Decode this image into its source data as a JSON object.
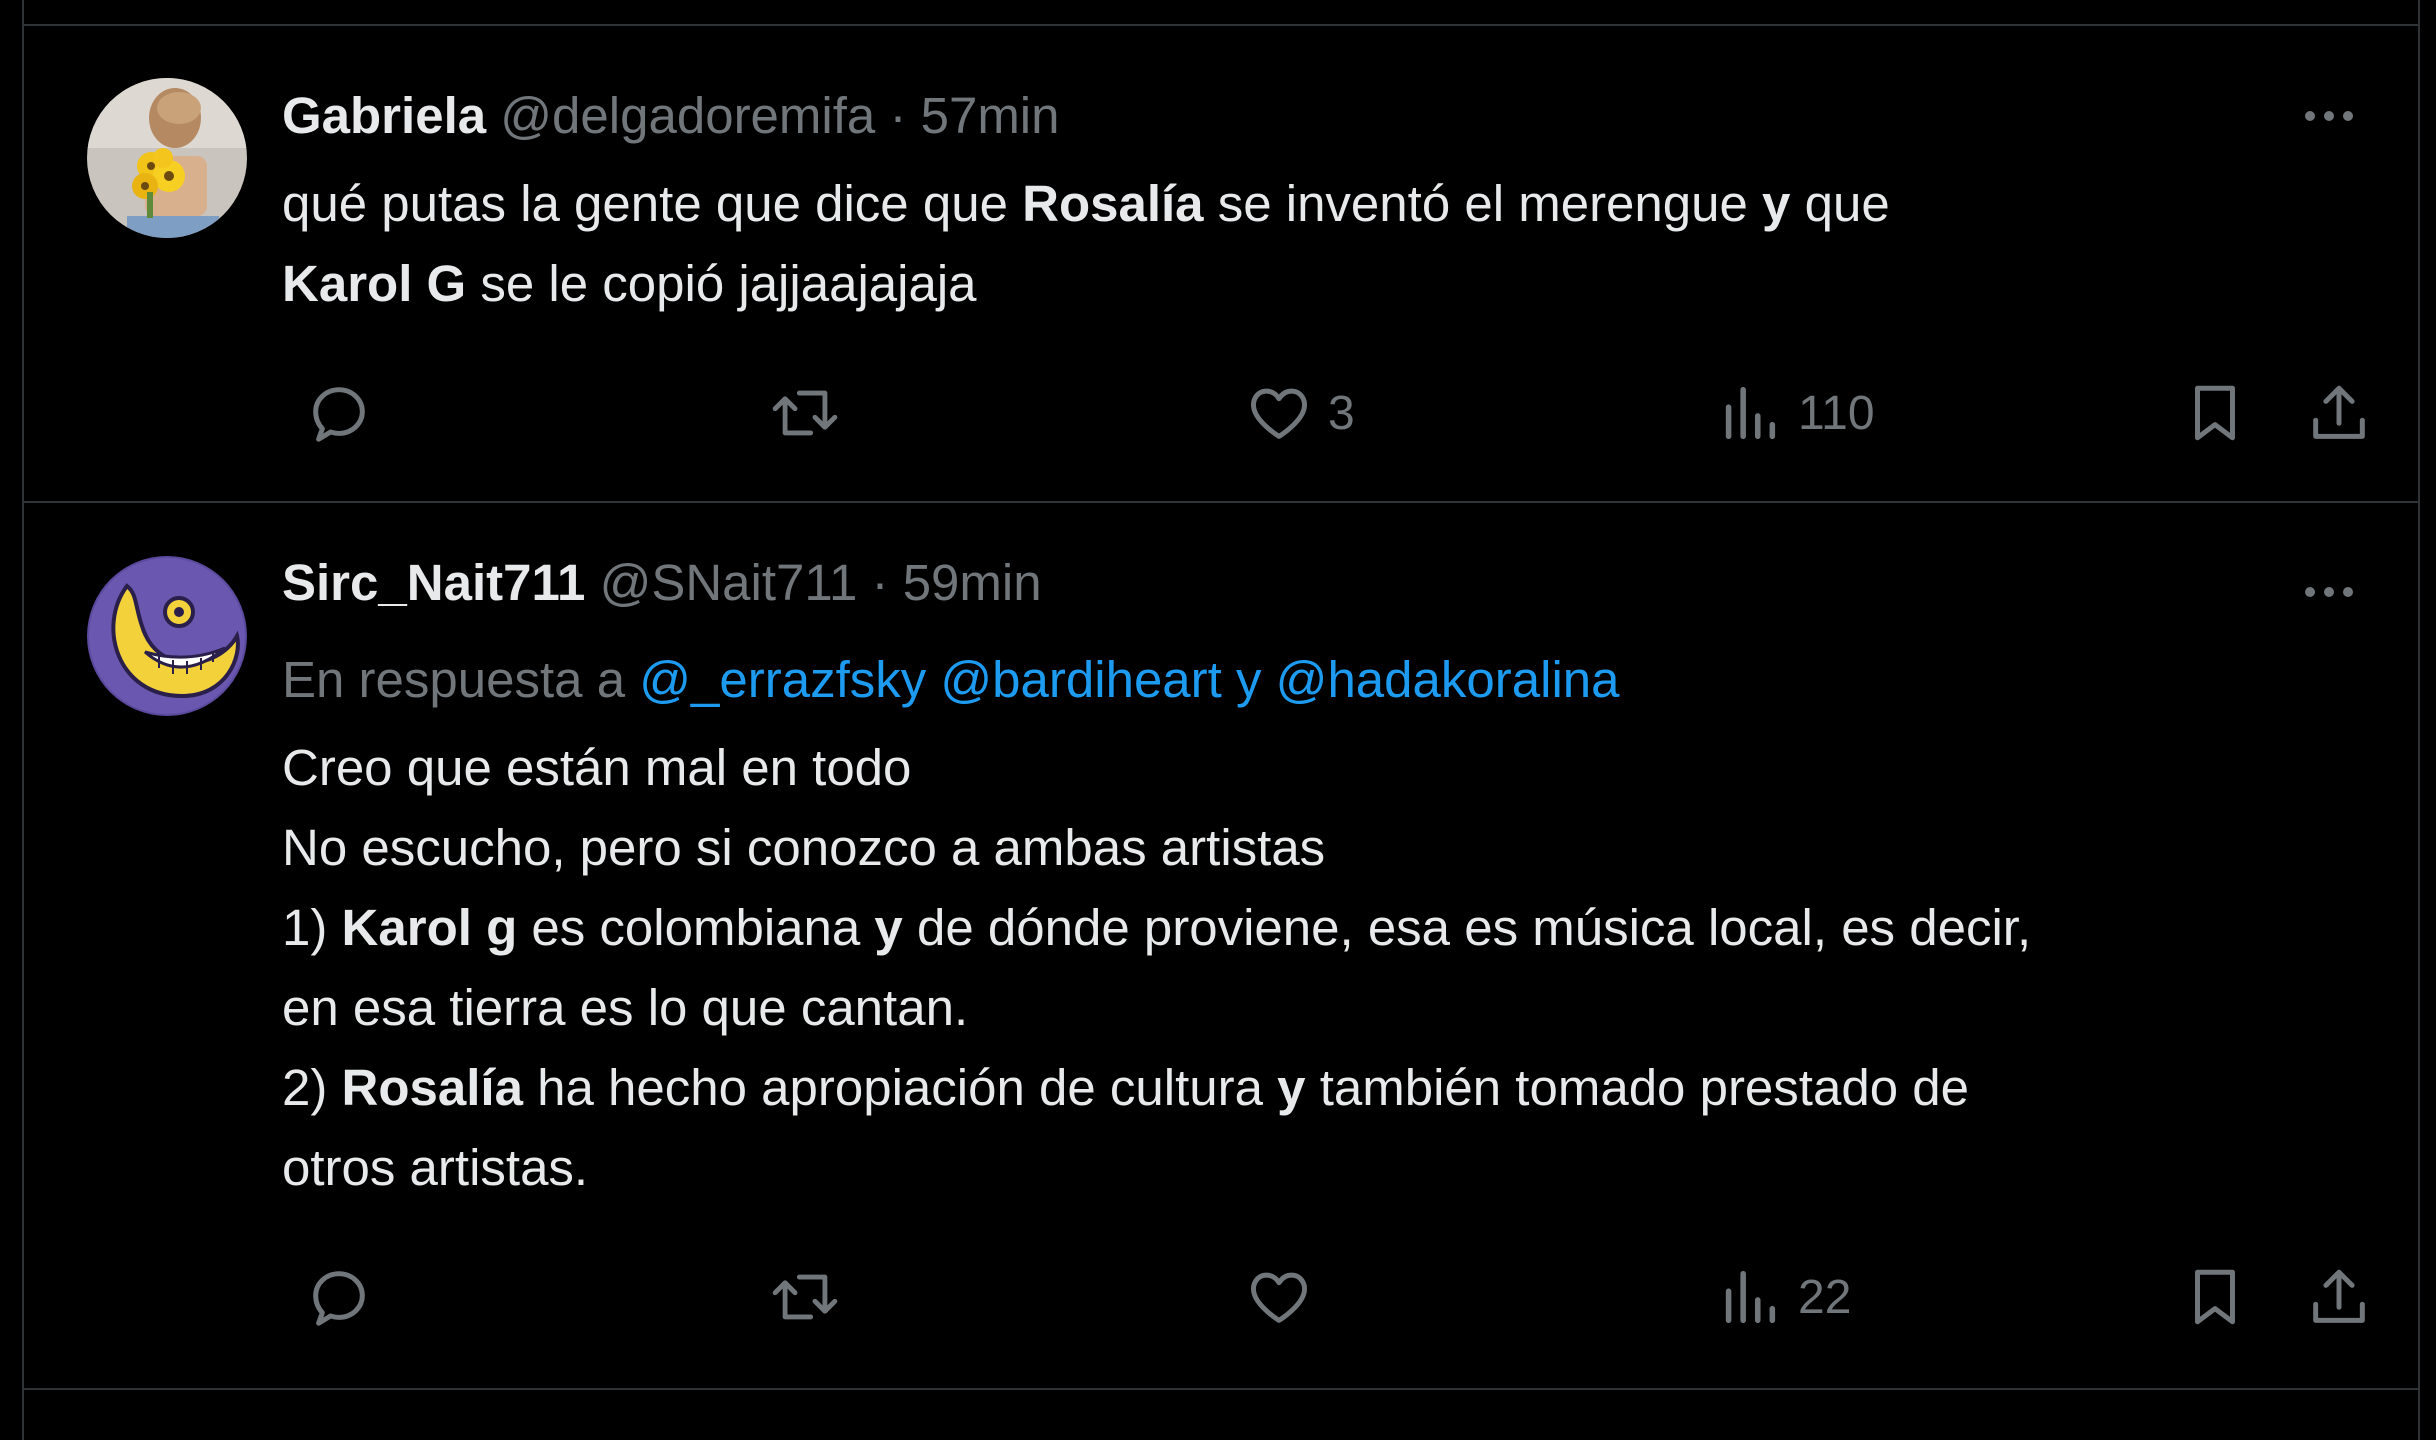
{
  "tweets": [
    {
      "display_name": "Gabriela",
      "handle": "@delgadoremifa",
      "separator": "·",
      "time": "57min",
      "avatar_icon": "profile-photo-with-sunflowers",
      "text_parts_line1": [
        "qué putas la gente que dice que ",
        "Rosalía",
        " se inventó el merengue ",
        "y",
        " que"
      ],
      "text_parts_line2": [
        "Karol G",
        " se le copió jajjaajajaja"
      ],
      "reply_count": "",
      "retweet_count": "",
      "like_count": "3",
      "view_count": "110"
    },
    {
      "display_name": "Sirc_Nait711",
      "handle": "@SNait711",
      "separator": "·",
      "time": "59min",
      "avatar_icon": "crescent-moon-face-avatar",
      "reply_prefix": "En respuesta a",
      "mention1": "@_errazfsky",
      "mention2": "@bardiheart",
      "mention_joiner": "y",
      "mention3": "@hadakoralina",
      "line1": "Creo que están mal en todo",
      "line2": "No escucho, pero si conozco a ambas artistas",
      "line3_parts": [
        "1) ",
        "Karol g",
        " es colombiana ",
        "y",
        " de dónde proviene, esa es música local, es decir,"
      ],
      "line4": "en esa tierra es lo que cantan.",
      "line5_parts": [
        "2) ",
        "Rosalía",
        " ha hecho apropiación de cultura ",
        "y",
        " también tomado prestado de"
      ],
      "line6": "otros artistas.",
      "reply_count": "",
      "retweet_count": "",
      "like_count": "",
      "view_count": "22"
    }
  ],
  "icons": {
    "more": "more-icon",
    "reply": "reply-icon",
    "retweet": "retweet-icon",
    "like": "heart-icon",
    "views": "views-icon",
    "bookmark": "bookmark-icon",
    "share": "share-icon"
  },
  "colors": {
    "background": "#000000",
    "text": "#e7e9ea",
    "muted": "#71767b",
    "mention": "#1d9bf0",
    "divider": "#2f3336"
  }
}
